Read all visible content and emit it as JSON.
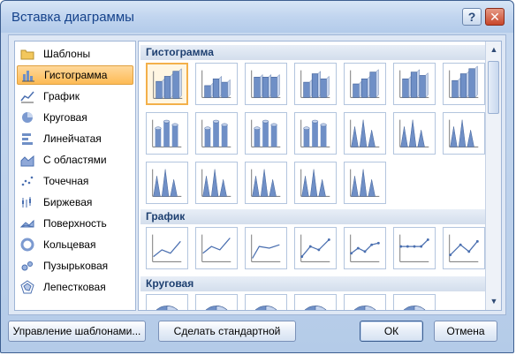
{
  "window": {
    "title": "Вставка диаграммы",
    "help_label": "?",
    "close_label": "✕"
  },
  "categories": [
    {
      "label": "Шаблоны",
      "icon": "folder-icon",
      "active": false
    },
    {
      "label": "Гистограмма",
      "icon": "column-chart-icon",
      "active": true
    },
    {
      "label": "График",
      "icon": "line-chart-icon",
      "active": false
    },
    {
      "label": "Круговая",
      "icon": "pie-chart-icon",
      "active": false
    },
    {
      "label": "Линейчатая",
      "icon": "bar-chart-icon",
      "active": false
    },
    {
      "label": "С областями",
      "icon": "area-chart-icon",
      "active": false
    },
    {
      "label": "Точечная",
      "icon": "scatter-chart-icon",
      "active": false
    },
    {
      "label": "Биржевая",
      "icon": "stock-chart-icon",
      "active": false
    },
    {
      "label": "Поверхность",
      "icon": "surface-chart-icon",
      "active": false
    },
    {
      "label": "Кольцевая",
      "icon": "doughnut-chart-icon",
      "active": false
    },
    {
      "label": "Пузырьковая",
      "icon": "bubble-chart-icon",
      "active": false
    },
    {
      "label": "Лепестковая",
      "icon": "radar-chart-icon",
      "active": false
    }
  ],
  "sections": [
    {
      "title": "Гистограмма"
    },
    {
      "title": "График"
    },
    {
      "title": "Круговая"
    }
  ],
  "buttons": {
    "manage_templates": "Управление шаблонами...",
    "set_default": "Сделать стандартной",
    "ok": "ОК",
    "cancel": "Отмена"
  },
  "colors": {
    "accent": "#15428b",
    "selection": "#fdbb55",
    "bar_blue": "#6f8fc6"
  }
}
